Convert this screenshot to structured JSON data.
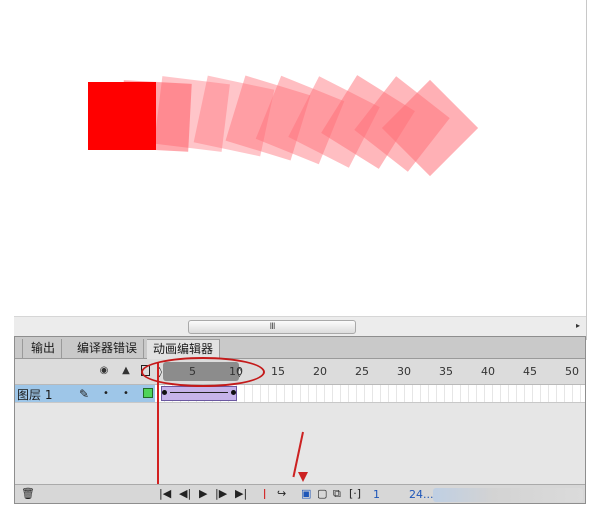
{
  "colors": {
    "square_red": "#ff0000",
    "onion_pink": "#ff6f78",
    "annotation_red": "#c41a1a",
    "layer_highlight": "#9ec6e8",
    "tween_purple": "#c6b3ea",
    "layer_color_swatch": "#4fd45a"
  },
  "scrollbar": {
    "grip_label": "III",
    "right_arrow": "▸"
  },
  "tabs": [
    {
      "label": ""
    },
    {
      "label": "输出"
    },
    {
      "label": "编译器错误"
    },
    {
      "label": "动画编辑器"
    }
  ],
  "timeline": {
    "header_icons": {
      "eye": "eye-icon",
      "lock": "lock-icon",
      "outline": "outline-icon"
    },
    "onion_marker_left": "◊",
    "onion_marker_right": "◊",
    "ruler_labels": [
      "5",
      "10",
      "15",
      "20",
      "25",
      "30",
      "35",
      "40",
      "45",
      "50"
    ],
    "layer": {
      "name": "图层 1",
      "pencil": "✎",
      "visible_dot": "•",
      "lock_dot": "•"
    }
  },
  "bottom_bar": {
    "trash": "🗑",
    "first_frame": "|◀",
    "prev_frame": "◀|",
    "play": "▶",
    "next_frame": "|▶",
    "last_frame": "▶|",
    "loop": "↪",
    "onion_skin": "▣",
    "onion_outlines": "▢",
    "edit_multiple": "⧉",
    "modify_markers": "[·]",
    "current_frame": "1",
    "fps": "24..."
  }
}
